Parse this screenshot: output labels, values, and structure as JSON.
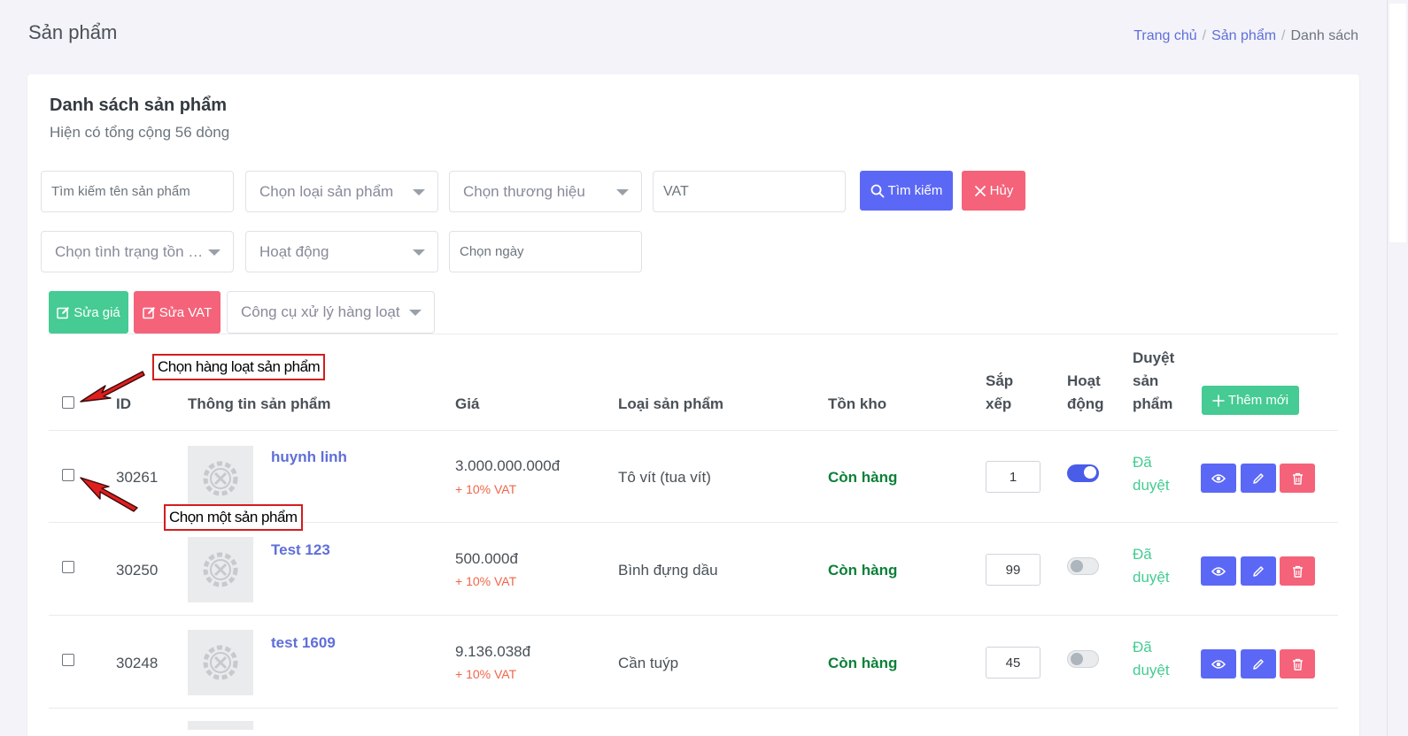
{
  "page": {
    "title": "Sản phẩm"
  },
  "breadcrumb": {
    "home": "Trang chủ",
    "section": "Sản phẩm",
    "current": "Danh sách",
    "separator": "/"
  },
  "card": {
    "title": "Danh sách sản phẩm",
    "subtitle": "Hiện có tổng cộng 56 dòng"
  },
  "filters": {
    "search_placeholder": "Tìm kiếm tên sản phẩm",
    "category_placeholder": "Chọn loại sản phẩm",
    "brand_placeholder": "Chọn thương hiệu",
    "vat_placeholder": "VAT",
    "search_button": "Tìm kiếm",
    "cancel_button": "Hủy",
    "stock_status_placeholder": "Chọn tình trạng tồn k...",
    "active_placeholder": "Hoạt động",
    "date_placeholder": "Chọn ngày"
  },
  "toolbar": {
    "edit_price": "Sửa giá",
    "edit_vat": "Sửa VAT",
    "bulk_tools_placeholder": "Công cụ xử lý hàng loạt"
  },
  "table": {
    "headers": {
      "id": "ID",
      "info": "Thông tin sản phẩm",
      "price": "Giá",
      "category": "Loại sản phẩm",
      "stock": "Tồn kho",
      "sort_1": "Sắp",
      "sort_2": "xếp",
      "active_1": "Hoạt",
      "active_2": "động",
      "approval_1": "Duyệt",
      "approval_2": "sản",
      "approval_3": "phẩm"
    },
    "add_button": "Thêm mới",
    "rows": [
      {
        "id": "30261",
        "name": "huynh linh",
        "price": "3.000.000.000đ",
        "vat": "+ 10% VAT",
        "category": "Tô vít (tua vít)",
        "stock": "Còn hàng",
        "sort": "1",
        "active": true,
        "approval": "Đã duyệt"
      },
      {
        "id": "30250",
        "name": "Test 123",
        "price": "500.000đ",
        "vat": "+ 10% VAT",
        "category": "Bình đựng dầu",
        "stock": "Còn hàng",
        "sort": "99",
        "active": false,
        "approval": "Đã duyệt"
      },
      {
        "id": "30248",
        "name": "test 1609",
        "price": "9.136.038đ",
        "vat": "+ 10% VAT",
        "category": "Cần tuýp",
        "stock": "Còn hàng",
        "sort": "45",
        "active": false,
        "approval": "Đã duyệt"
      }
    ]
  },
  "annotations": {
    "select_all": "Chọn hàng loạt sản phẩm",
    "select_one": "Chọn một sản phẩm"
  },
  "colors": {
    "primary": "#5b68f5",
    "danger": "#f4637a",
    "success": "#45cb93",
    "in_stock": "#0c8038",
    "link": "#5f6fd8",
    "annotation": "#d41d1d"
  }
}
